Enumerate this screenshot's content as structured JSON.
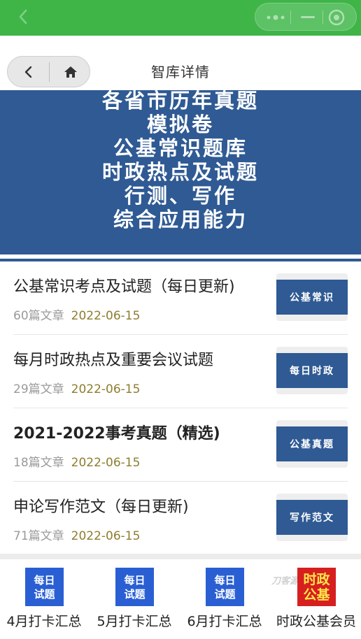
{
  "page": {
    "nav_title": "智库详情"
  },
  "banner": {
    "lines": [
      "各省市历年真题",
      "模拟卷",
      "公基常识题库",
      "时政热点及试题",
      "行测、写作",
      "综合应用能力"
    ]
  },
  "articles": [
    {
      "title": "公基常识考点及试题（每日更新)",
      "count": "60篇文章",
      "date": "2022-06-15",
      "thumb": "公基常识"
    },
    {
      "title": "每月时政热点及重要会议试题",
      "count": "29篇文章",
      "date": "2022-06-15",
      "thumb": "每日时政"
    },
    {
      "title": "2021-2022事考真题（精选)",
      "count": "18篇文章",
      "date": "2022-06-15",
      "thumb": "公基真题"
    },
    {
      "title": "申论写作范文（每日更新)",
      "count": "71篇文章",
      "date": "2022-06-15",
      "thumb": "写作范文"
    }
  ],
  "shortcuts": [
    {
      "label": "4月打卡汇总",
      "icon_line1": "每日",
      "icon_line2": "试题"
    },
    {
      "label": "5月打卡汇总",
      "icon_line1": "每日",
      "icon_line2": "试题"
    },
    {
      "label": "6月打卡汇总",
      "icon_line1": "每日",
      "icon_line2": "试题"
    },
    {
      "label": "时政公基会员",
      "icon_line1": "时政",
      "icon_line2": "公基"
    }
  ],
  "watermark": "刀客源码",
  "colors": {
    "topbar": "#3fb548",
    "banner": "#2f5a94",
    "date": "#8d7d2e",
    "shortcut_icon": "#2a5fd4",
    "vip_icon": "#d71f1f"
  },
  "icons": {
    "back": "chevron-left-icon",
    "more": "more-dots-icon",
    "minimize": "minus-icon",
    "close": "target-icon",
    "home": "home-icon"
  }
}
